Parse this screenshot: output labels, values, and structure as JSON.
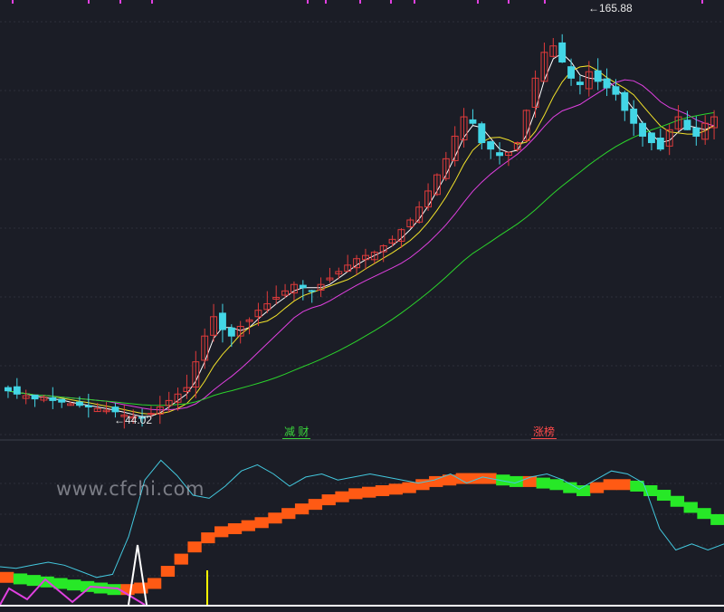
{
  "watermark": "www.cfchi.com",
  "price_labels": {
    "high": "165.88",
    "low": "44.02"
  },
  "signals": {
    "sell": "减 财",
    "buy": "涨榜"
  },
  "colors": {
    "background": "#1b1d26",
    "candle_up": "#e03b3b",
    "candle_down": "#43d6e6",
    "ma_short": "#ffffff",
    "ma_mid": "#f2e22a",
    "ma_long": "#e040e0",
    "ma_very_long": "#2bd42b",
    "band_up": "#ff5a14",
    "band_down": "#27e827",
    "oscillator": "#43c8de",
    "ind_magenta": "#e040e0",
    "ind_yellow": "#ffff00",
    "ind_white": "#ffffff"
  },
  "chart_data": [
    {
      "type": "candlestick",
      "title": "",
      "price_high": 165.88,
      "price_low": 44.02,
      "ylim": [
        40,
        172
      ],
      "close": [
        53,
        52,
        51.5,
        50.5,
        51,
        50,
        49.5,
        49,
        48.5,
        48,
        47.5,
        47,
        46.5,
        45.5,
        45,
        44.5,
        46,
        48,
        50,
        52,
        54,
        62,
        70,
        76,
        72,
        70,
        73,
        75,
        78,
        80,
        82,
        84,
        86,
        85,
        84,
        86,
        88,
        90,
        92,
        94,
        95,
        96,
        98,
        100,
        103,
        106,
        110,
        115,
        120,
        125,
        132,
        138,
        136,
        130,
        128,
        126,
        127,
        130,
        140,
        150,
        158,
        160,
        155,
        150,
        148,
        152,
        149,
        147,
        145,
        140,
        136,
        132,
        130,
        128,
        134,
        138,
        134,
        132,
        136,
        138
      ],
      "series": [
        {
          "name": "",
          "role": "ma_short"
        },
        {
          "name": "",
          "role": "ma_mid"
        },
        {
          "name": "",
          "role": "ma_long"
        },
        {
          "name": "",
          "role": "ma_very_long"
        }
      ]
    },
    {
      "type": "indicator",
      "title": "",
      "band_values": [
        0.18,
        0.17,
        0.16,
        0.15,
        0.14,
        0.13,
        0.12,
        0.11,
        0.1,
        0.1,
        0.11,
        0.14,
        0.22,
        0.3,
        0.38,
        0.44,
        0.48,
        0.5,
        0.52,
        0.54,
        0.57,
        0.6,
        0.63,
        0.66,
        0.69,
        0.71,
        0.73,
        0.74,
        0.75,
        0.76,
        0.77,
        0.79,
        0.81,
        0.82,
        0.83,
        0.83,
        0.83,
        0.82,
        0.81,
        0.81,
        0.8,
        0.79,
        0.77,
        0.75,
        0.77,
        0.79,
        0.79,
        0.78,
        0.75,
        0.72,
        0.68,
        0.64,
        0.6,
        0.56
      ],
      "oscillator_values": [
        0.25,
        0.24,
        0.26,
        0.28,
        0.26,
        0.22,
        0.18,
        0.2,
        0.45,
        0.82,
        0.95,
        0.85,
        0.72,
        0.7,
        0.78,
        0.88,
        0.92,
        0.86,
        0.78,
        0.84,
        0.86,
        0.82,
        0.84,
        0.86,
        0.84,
        0.82,
        0.8,
        0.82,
        0.86,
        0.8,
        0.84,
        0.82,
        0.8,
        0.84,
        0.86,
        0.82,
        0.76,
        0.82,
        0.88,
        0.86,
        0.8,
        0.5,
        0.36,
        0.4,
        0.36,
        0.4
      ]
    }
  ]
}
